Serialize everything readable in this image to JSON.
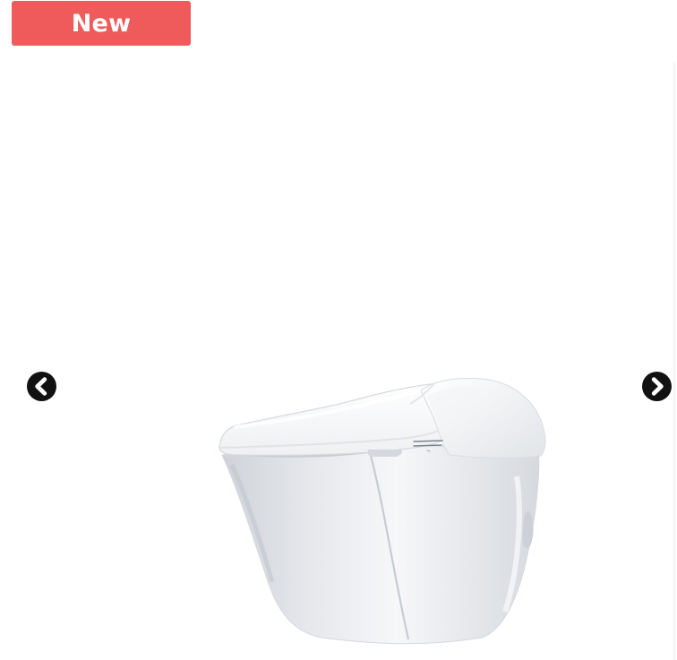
{
  "badge": {
    "label": "New",
    "color": "#ef5b5b"
  },
  "carousel": {
    "previous_icon": "chevron-left-icon",
    "next_icon": "chevron-right-icon"
  },
  "product": {
    "image_icon": "smart-toilet-icon"
  }
}
